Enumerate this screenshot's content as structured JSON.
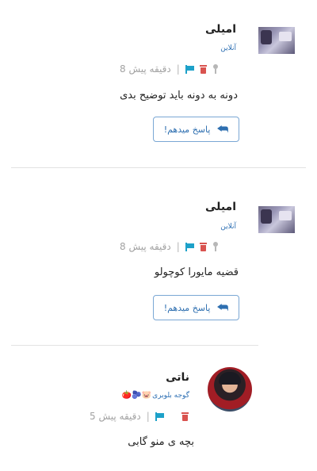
{
  "comments": [
    {
      "author": "امیلی",
      "status": "آنلاین",
      "time": "8 دقیقه پیش",
      "separator": "|",
      "text": "دونه به دونه باید توضیح بدی",
      "reply_label": "پاسخ میدهم!"
    },
    {
      "author": "امیلی",
      "status": "آنلاین",
      "time": "8 دقیقه پیش",
      "separator": "|",
      "text": "قضیه مایورا کوچولو",
      "reply_label": "پاسخ میدهم!"
    },
    {
      "author": "ناتی",
      "status": "گوجه بلوبری",
      "badges": "🍅🫐🐷",
      "time": "5 دقیقه پیش",
      "separator": "|",
      "text": "بچه ی منو گابی"
    }
  ],
  "icons": {
    "reply": "reply-arrow-icon",
    "flag": "flag-icon",
    "trash": "trash-icon",
    "pin": "pin-icon"
  },
  "colors": {
    "status_text": "#2d6fb3",
    "flag": "#1da1c9",
    "trash": "#d9534f",
    "reply_border": "#7aa7d4"
  }
}
